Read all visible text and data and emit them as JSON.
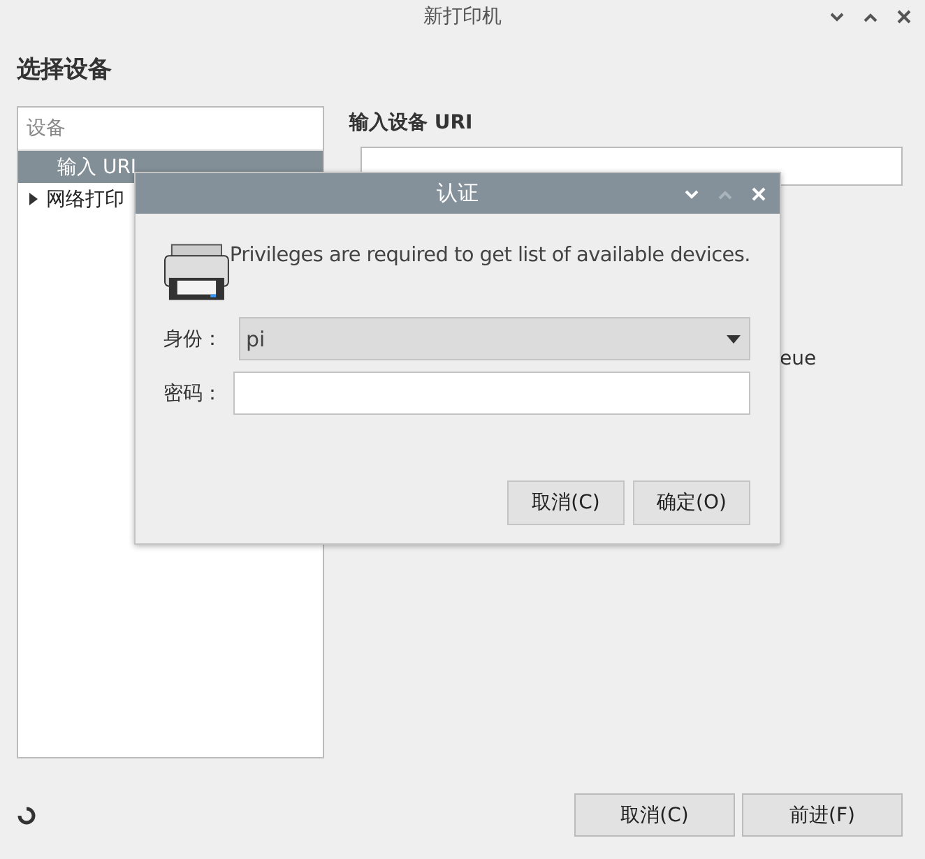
{
  "window": {
    "title": "新打印机"
  },
  "heading": "选择设备",
  "device_list": {
    "header": "设备",
    "items": [
      {
        "label": "输入 URI",
        "selected": true,
        "expandable": false
      },
      {
        "label": "网络打印",
        "selected": false,
        "expandable": true
      }
    ]
  },
  "uri_section": {
    "label": "输入设备 URI"
  },
  "partial_text": "eue",
  "buttons": [
    "取消(C)",
    "前进(F)"
  ],
  "dialog": {
    "title": "认证",
    "message": "Privileges are required to get list of available devices.",
    "identity_label": "身份：",
    "identity_value": "pi",
    "password_label": "密码：",
    "buttons": [
      "取消(C)",
      "确定(O)"
    ]
  }
}
